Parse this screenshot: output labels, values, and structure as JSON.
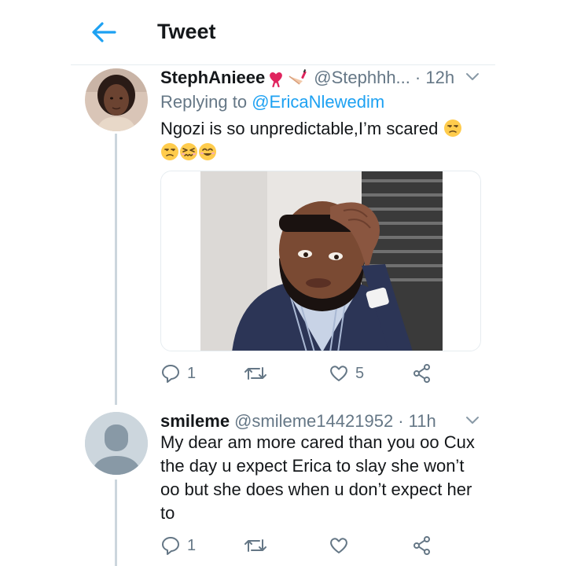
{
  "header": {
    "title": "Tweet",
    "back_icon": "arrow-left-icon",
    "accent": "#1da1f2"
  },
  "tweets": [
    {
      "display_name": "StephAnieee",
      "name_emojis": [
        "heart-ribbon-emoji",
        "nail-polish-emoji"
      ],
      "handle": "@Stephhh...",
      "time": "· 12h",
      "replying_prefix": "Replying to",
      "replying_to": "@EricaNlewedim",
      "text": "Ngozi is so unpredictable,I’m scared",
      "text_emojis": [
        "unamused-face-emoji",
        "unamused-face-emoji",
        "persevering-face-emoji",
        "smiling-face-emoji"
      ],
      "media": "photo-man-hand-on-head",
      "replies": "1",
      "retweets": "",
      "likes": "5"
    },
    {
      "display_name": "smileme",
      "handle": "@smileme14421952",
      "time": "· 11h",
      "text_lines": [
        "My dear am more cared than you oo Cux",
        "the day u expect Erica to slay she won’t",
        "oo but she does when u don’t expect her",
        "to"
      ],
      "replies": "1",
      "retweets": "",
      "likes": ""
    }
  ],
  "colors": {
    "text": "#14171a",
    "secondary": "#657786",
    "link": "#1da1f2",
    "divider": "#e6ecf0",
    "thread": "#ccd6dd"
  }
}
